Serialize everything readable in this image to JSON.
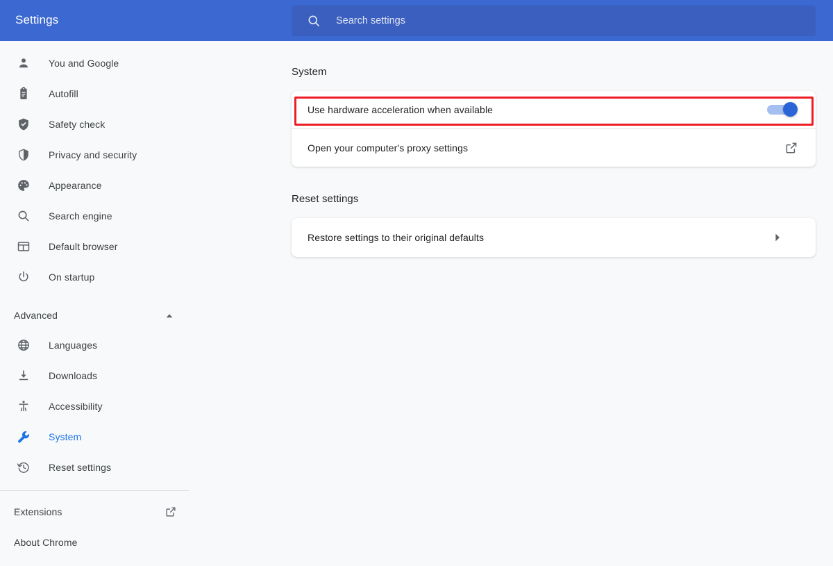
{
  "header": {
    "title": "Settings",
    "search": {
      "placeholder": "Search settings",
      "value": "",
      "icon": "search-icon"
    },
    "background_color": "#3c68d1"
  },
  "sidebar": {
    "items": [
      {
        "label": "You and Google",
        "icon": "person-icon",
        "active": false
      },
      {
        "label": "Autofill",
        "icon": "clipboard-icon",
        "active": false
      },
      {
        "label": "Safety check",
        "icon": "shield-check-icon",
        "active": false
      },
      {
        "label": "Privacy and security",
        "icon": "shield-icon",
        "active": false
      },
      {
        "label": "Appearance",
        "icon": "palette-icon",
        "active": false
      },
      {
        "label": "Search engine",
        "icon": "magnifier-icon",
        "active": false
      },
      {
        "label": "Default browser",
        "icon": "browser-window-icon",
        "active": false
      },
      {
        "label": "On startup",
        "icon": "power-icon",
        "active": false
      }
    ],
    "advanced_group": {
      "label": "Advanced",
      "expanded": true,
      "chevron_icon": "chevron-up-icon",
      "items": [
        {
          "label": "Languages",
          "icon": "globe-icon",
          "active": false
        },
        {
          "label": "Downloads",
          "icon": "download-icon",
          "active": false
        },
        {
          "label": "Accessibility",
          "icon": "accessibility-icon",
          "active": false
        },
        {
          "label": "System",
          "icon": "wrench-icon",
          "active": true
        },
        {
          "label": "Reset settings",
          "icon": "history-icon",
          "active": false
        }
      ]
    },
    "footer_items": [
      {
        "label": "Extensions",
        "icon": "external-link-icon"
      },
      {
        "label": "About Chrome",
        "icon": null
      }
    ],
    "active_color": "#1a73e8"
  },
  "main": {
    "sections": [
      {
        "title": "System",
        "rows": [
          {
            "label": "Use hardware acceleration when available",
            "control": "toggle",
            "toggle_state": "on",
            "highlighted": true
          },
          {
            "label": "Open your computer's proxy settings",
            "control": "external-link",
            "icon": "external-link-icon",
            "highlighted": false
          }
        ]
      },
      {
        "title": "Reset settings",
        "rows": [
          {
            "label": "Restore settings to their original defaults",
            "control": "chevron",
            "icon": "chevron-right-icon",
            "highlighted": false
          }
        ]
      }
    ]
  },
  "annotation": {
    "highlight_color": "#ee1c25",
    "target": "Use hardware acceleration when available"
  }
}
